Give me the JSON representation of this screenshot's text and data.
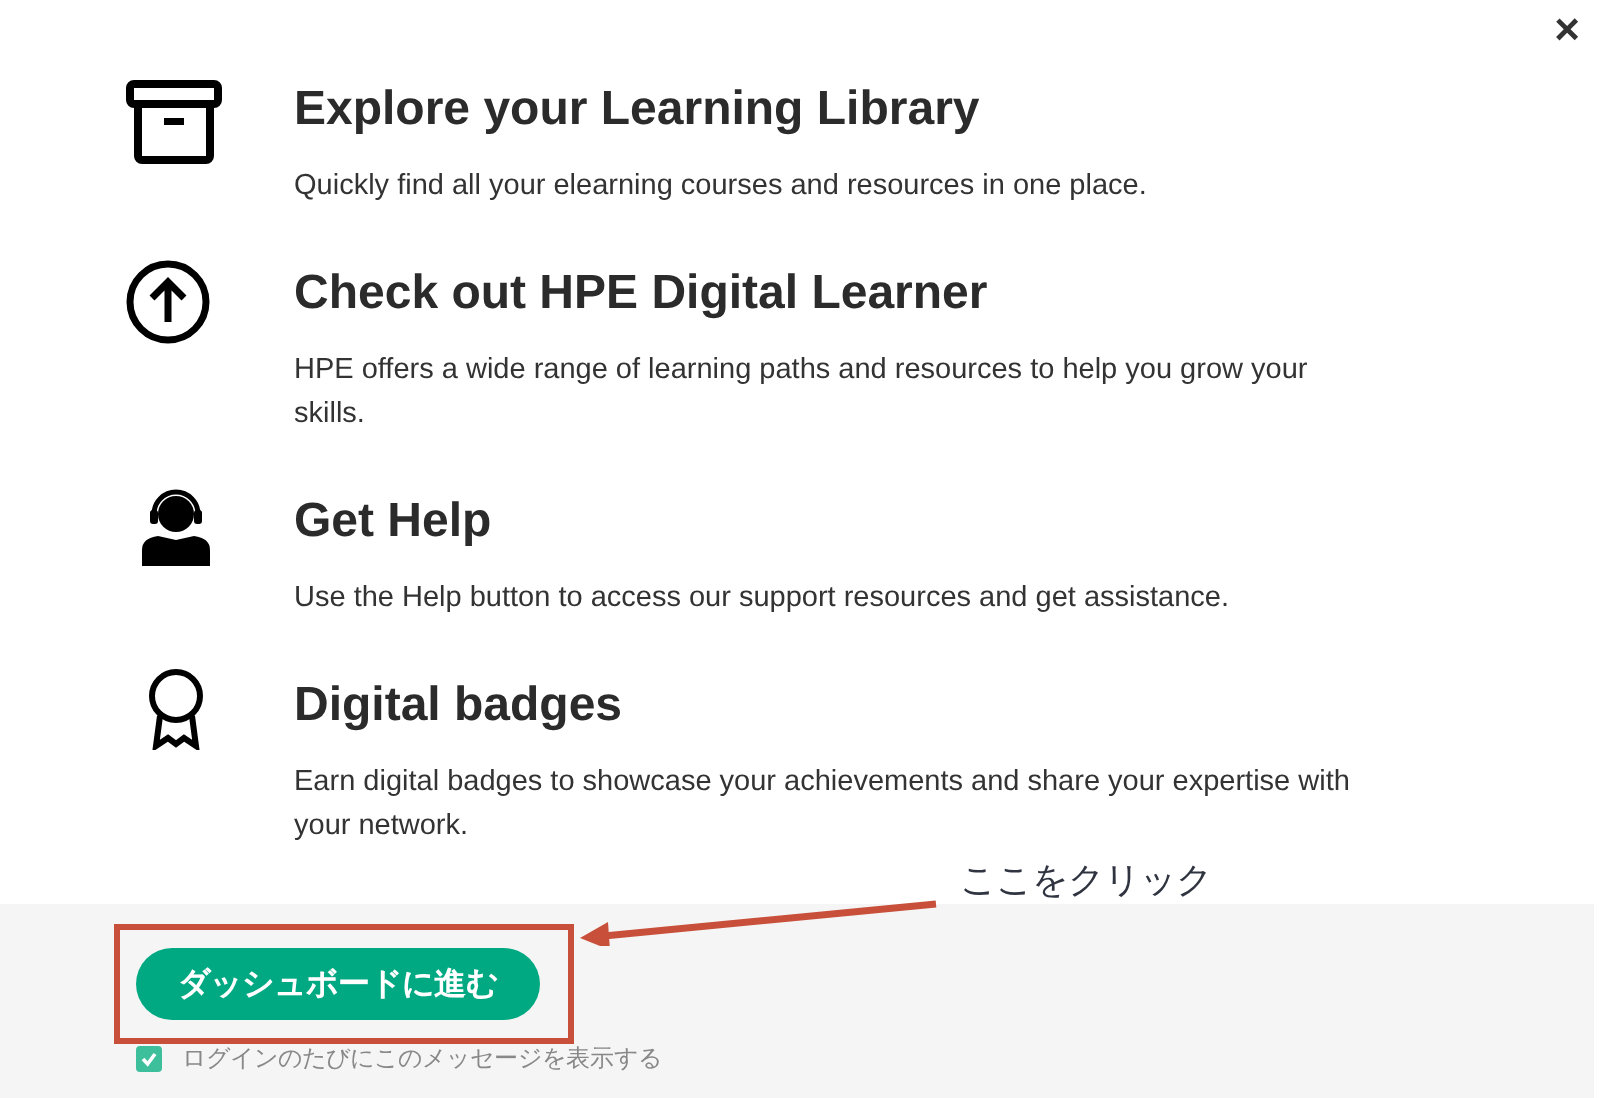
{
  "close": {
    "glyph": "×"
  },
  "items": [
    {
      "title": "Explore your Learning Library",
      "description": "Quickly find all your elearning courses and resources in one place."
    },
    {
      "title": "Check out HPE Digital Learner",
      "description": "HPE offers a wide range of learning paths and resources to help you grow your skills."
    },
    {
      "title": "Get Help",
      "description": "Use the Help button to access our support resources and get assistance."
    },
    {
      "title": "Digital badges",
      "description": "Earn digital badges to showcase your achievements and share your expertise with your network."
    }
  ],
  "footer": {
    "button": "ダッシュボードに進む",
    "checkbox": {
      "label": "ログインのたびにこのメッセージを表示する",
      "checked": true
    }
  },
  "annotation": {
    "label": "ここをクリック"
  }
}
